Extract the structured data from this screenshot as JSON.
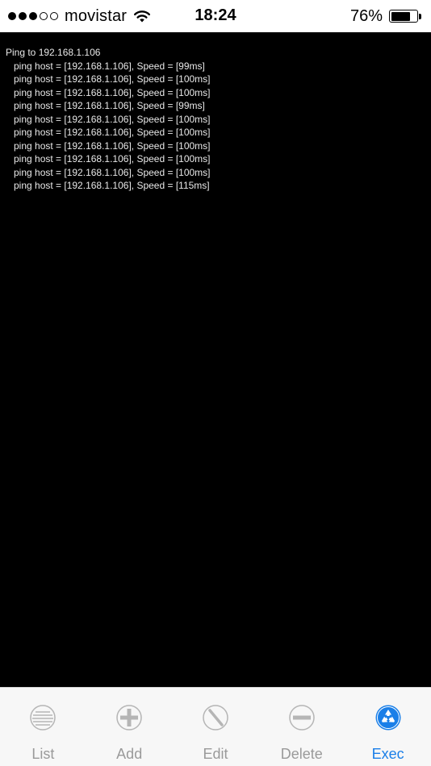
{
  "status_bar": {
    "carrier": "movistar",
    "time": "18:24",
    "battery_percent": "76%",
    "battery_level": 0.76,
    "signal_bars_filled": 3,
    "signal_bars_total": 5
  },
  "console": {
    "title": "Ping to 192.168.1.106",
    "lines": [
      "ping host = [192.168.1.106], Speed = [99ms]",
      "ping host = [192.168.1.106], Speed = [100ms]",
      "ping host = [192.168.1.106], Speed = [100ms]",
      "ping host = [192.168.1.106], Speed = [99ms]",
      "ping host = [192.168.1.106], Speed = [100ms]",
      "ping host = [192.168.1.106], Speed = [100ms]",
      "ping host = [192.168.1.106], Speed = [100ms]",
      "ping host = [192.168.1.106], Speed = [100ms]",
      "ping host = [192.168.1.106], Speed = [100ms]",
      "ping host = [192.168.1.106], Speed = [115ms]"
    ]
  },
  "tab_bar": {
    "tabs": [
      {
        "label": "List",
        "icon": "list-icon",
        "active": false
      },
      {
        "label": "Add",
        "icon": "add-icon",
        "active": false
      },
      {
        "label": "Edit",
        "icon": "edit-icon",
        "active": false
      },
      {
        "label": "Delete",
        "icon": "delete-icon",
        "active": false
      },
      {
        "label": "Exec",
        "icon": "recycle-icon",
        "active": true
      }
    ],
    "colors": {
      "active": "#1a7fe8",
      "inactive": "#9a9a9a"
    }
  }
}
